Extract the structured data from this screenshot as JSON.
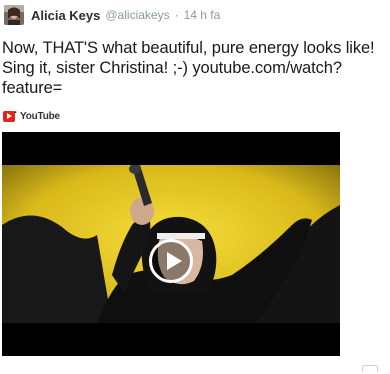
{
  "tweet": {
    "author": {
      "name": "Alicia Keys",
      "handle": "@aliciakeys",
      "avatar_icon": "avatar-photo-icon"
    },
    "timestamp": "14 h fa",
    "separator": "·",
    "text": {
      "part1": "Now, THAT'S what beautiful, pure energy looks like! Sing it, sister Christina! ;-) ",
      "link": "youtube.com/watch?feature=",
      "ellipsis": "…"
    },
    "media": {
      "source_label": "YouTube",
      "source_icon": "youtube-logo-icon",
      "play_icon": "play-icon"
    }
  },
  "colors": {
    "text": "#1a1a1a",
    "secondary_text": "#8899a6",
    "youtube_red": "#e62117",
    "video_background": "#000000",
    "stage_yellow": "#e8c81c"
  }
}
